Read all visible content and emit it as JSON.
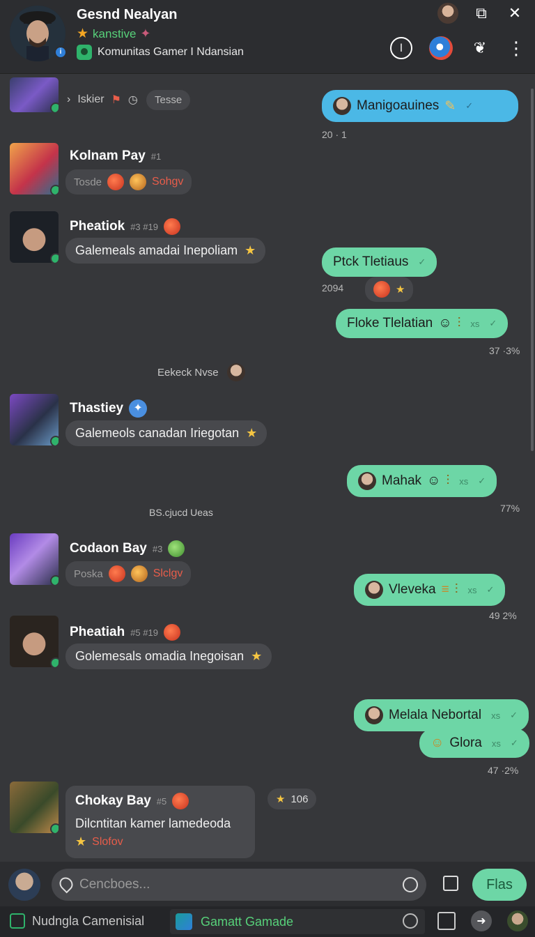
{
  "header": {
    "name": "Gesnd Nealyan",
    "status": "kanstive",
    "community": "Komunitas Gamer I Ndansian"
  },
  "messages": {
    "top_row": {
      "arrow_text": "Iskier",
      "pill_text": "Tesse"
    },
    "out1": {
      "text": "Manigoauines",
      "time": "20 · 1"
    },
    "kolnam": {
      "name": "Kolnam Pay",
      "meta": "#1",
      "reaction_text": "Tosde",
      "reaction_label": "Sohgv"
    },
    "pheatiok": {
      "name": "Pheatiok",
      "meta": "#3  #19",
      "text": "Galemeals amadai Inepoliam"
    },
    "out2": {
      "text": "Ptck Tletiaus",
      "time": "2094"
    },
    "out3": {
      "text": "Floke Tlelatian",
      "tick": "xs",
      "time": "37 ·3%"
    },
    "sys1": {
      "text": "Eekeck Nvse"
    },
    "thastiey": {
      "name": "Thastiey",
      "text": "Galemeols canadan Iriegotan"
    },
    "out4": {
      "text": "Mahak",
      "tick": "xs",
      "time": "77%"
    },
    "sys2": {
      "text": "BS.cjucd Ueas"
    },
    "codaon": {
      "name": "Codaon Bay",
      "meta": "#3",
      "reaction_text": "Poska",
      "reaction_label": "Slclgv"
    },
    "out5": {
      "text": "Vleveka",
      "tick": "xs",
      "time": "49  2%"
    },
    "pheatiah": {
      "name": "Pheatiah",
      "meta": "#5  #19",
      "text": "Golemesals omadia Inegoisan"
    },
    "out6": {
      "text": "Melala Nebortal",
      "tick": "xs"
    },
    "out7": {
      "text": "Glora",
      "tick": "xs",
      "time": "47 ·2%"
    },
    "chokay": {
      "name": "Chokay Bay",
      "meta": "#5",
      "text": "Dilcntitan kamer lamedeoda",
      "reaction_label": "Slofov",
      "star_count": "106"
    }
  },
  "input": {
    "placeholder": "Cencboes...",
    "send_label": "Flas"
  },
  "bottom": {
    "tab1": "Nudngla Camenisial",
    "tab2": "Gamatt Gamade"
  }
}
